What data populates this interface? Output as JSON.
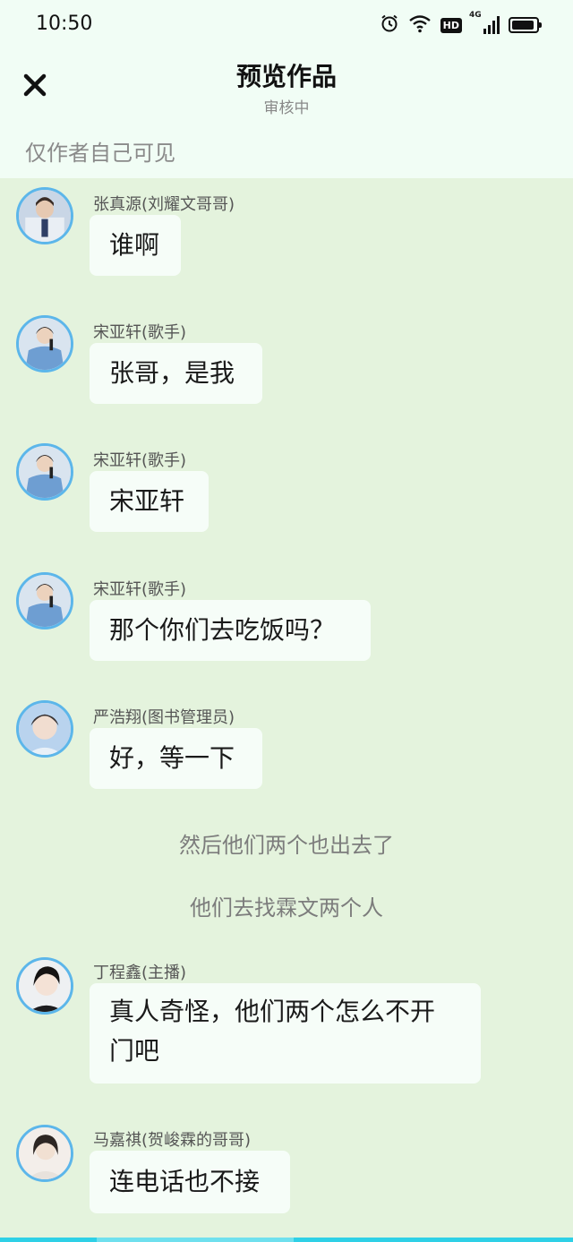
{
  "status_bar": {
    "time": "10:50",
    "signal_label": "4G",
    "hd_label": "HD",
    "icons": [
      "alarm-icon",
      "wifi-icon",
      "hd-icon",
      "signal-icon",
      "battery-icon"
    ]
  },
  "header": {
    "title": "预览作品",
    "subtitle": "审核中",
    "close_icon": "close-icon"
  },
  "visibility_note": "仅作者自己可见",
  "colors": {
    "top_bg": "#f1fdf5",
    "chat_bg": "#e4f3dd",
    "bubble_bg": "#f6fdf8",
    "avatar_ring": "#5cb6ea",
    "bottom_bar": "#2ed0e6"
  },
  "messages": [
    {
      "type": "message",
      "sender": "张真源(刘耀文哥哥)",
      "text": "谁啊"
    },
    {
      "type": "message",
      "sender": "宋亚轩(歌手)",
      "text": "张哥，是我"
    },
    {
      "type": "message",
      "sender": "宋亚轩(歌手)",
      "text": "宋亚轩"
    },
    {
      "type": "message",
      "sender": "宋亚轩(歌手)",
      "text": "那个你们去吃饭吗？"
    },
    {
      "type": "message",
      "sender": "严浩翔(图书管理员)",
      "text": "好，等一下"
    },
    {
      "type": "narration",
      "text": "然后他们两个也出去了"
    },
    {
      "type": "narration",
      "text": "他们去找霖文两个人"
    },
    {
      "type": "message",
      "sender": "丁程鑫(主播)",
      "text_lines": [
        "真人奇怪，他们两个怎么不开",
        "门吧"
      ]
    },
    {
      "type": "message",
      "sender": "马嘉祺(贺峻霖的哥哥)",
      "text": "连电话也不接"
    }
  ]
}
